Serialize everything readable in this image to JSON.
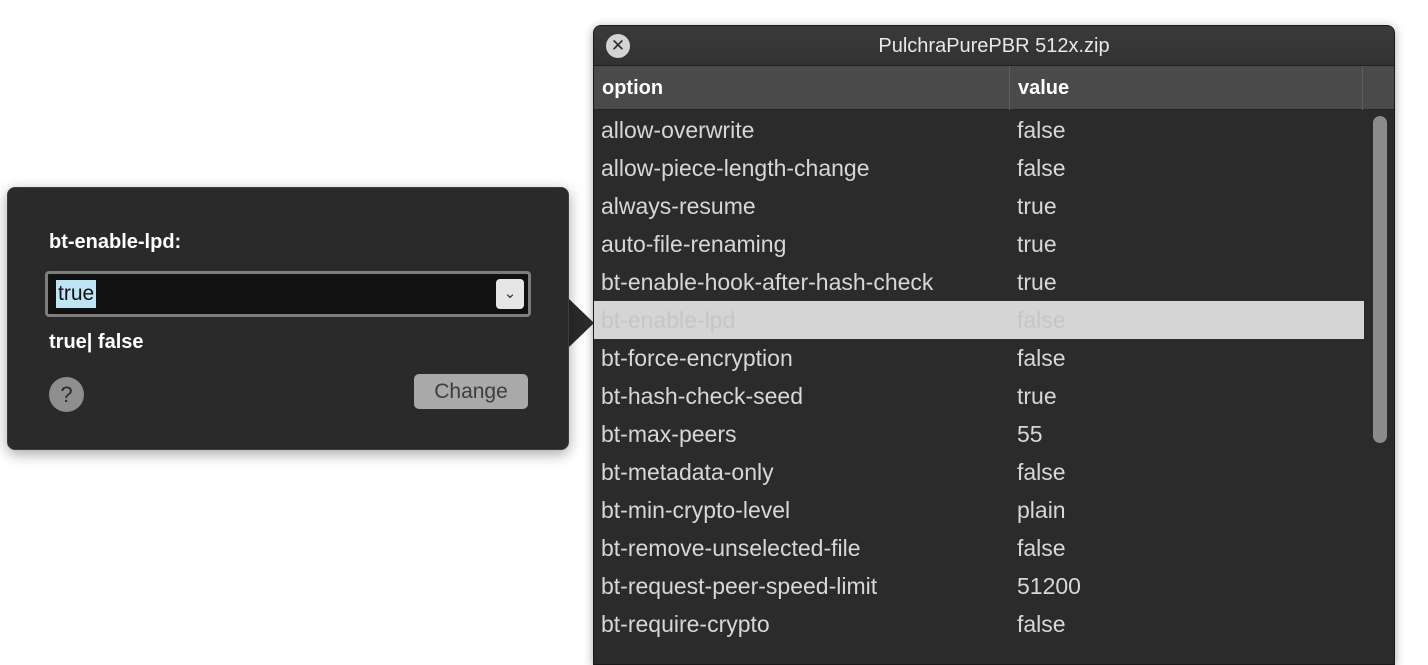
{
  "window": {
    "title": "PulchraPurePBR 512x.zip",
    "close_icon": "close-icon"
  },
  "table": {
    "columns": [
      "option",
      "value"
    ],
    "selected_index": 5,
    "rows": [
      {
        "option": "allow-overwrite",
        "value": "false"
      },
      {
        "option": "allow-piece-length-change",
        "value": "false"
      },
      {
        "option": "always-resume",
        "value": "true"
      },
      {
        "option": "auto-file-renaming",
        "value": "true"
      },
      {
        "option": "bt-enable-hook-after-hash-check",
        "value": "true"
      },
      {
        "option": "bt-enable-lpd",
        "value": "false"
      },
      {
        "option": "bt-force-encryption",
        "value": "false"
      },
      {
        "option": "bt-hash-check-seed",
        "value": "true"
      },
      {
        "option": "bt-max-peers",
        "value": "55"
      },
      {
        "option": "bt-metadata-only",
        "value": "false"
      },
      {
        "option": "bt-min-crypto-level",
        "value": "plain"
      },
      {
        "option": "bt-remove-unselected-file",
        "value": "false"
      },
      {
        "option": "bt-request-peer-speed-limit",
        "value": "51200"
      },
      {
        "option": "bt-require-crypto",
        "value": "false"
      }
    ]
  },
  "popover": {
    "label": "bt-enable-lpd:",
    "combo_value": "true",
    "hint": "true| false",
    "help_icon": "question-icon",
    "change_label": "Change"
  }
}
